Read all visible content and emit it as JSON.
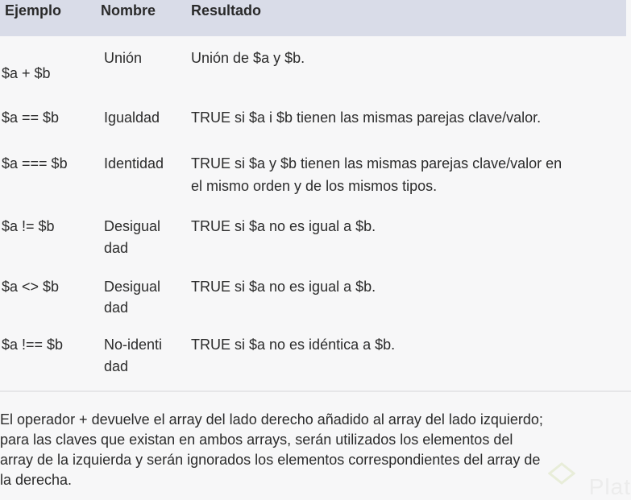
{
  "table": {
    "headers": [
      "Ejemplo",
      "Nombre",
      "Resultado"
    ],
    "rows": [
      {
        "example": "$a + $b",
        "name": "Unión",
        "result": "Unión de $a y $b."
      },
      {
        "example": "$a == $b",
        "name": "Igualdad",
        "result": "TRUE si $a i $b tienen las mismas parejas clave/valor."
      },
      {
        "example": "$a === $b",
        "name": "Identidad",
        "result_line1": "TRUE si $a y $b tienen las mismas parejas clave/valor en",
        "result_line2": "el mismo orden y de los mismos tipos."
      },
      {
        "example": "$a != $b",
        "name_line1": "Desigual",
        "name_line2": "dad",
        "result": "TRUE si $a no es igual a $b."
      },
      {
        "example": "$a <> $b",
        "name_line1": "Desigual",
        "name_line2": "dad",
        "result": "TRUE si $a no es igual a $b."
      },
      {
        "example": "$a !== $b",
        "name_line1": "No-identi",
        "name_line2": "dad",
        "result": "TRUE si $a no es idéntica a $b."
      }
    ]
  },
  "paragraph": {
    "line1": "El operador + devuelve el array del lado derecho añadido al array del lado izquierdo;",
    "line2": "para las claves que existan en ambos arrays, serán utilizados los elementos del",
    "line3": "array de la izquierda y serán ignorados los elementos correspondientes del array de",
    "line4": "la derecha."
  },
  "watermark": {
    "text": "Plat",
    "icon": "platzi-logo-icon",
    "color": "#ececec"
  },
  "colors": {
    "header_bg": "#d9dce8",
    "page_bg": "#f7f7f8",
    "text": "#2b2b2b"
  }
}
